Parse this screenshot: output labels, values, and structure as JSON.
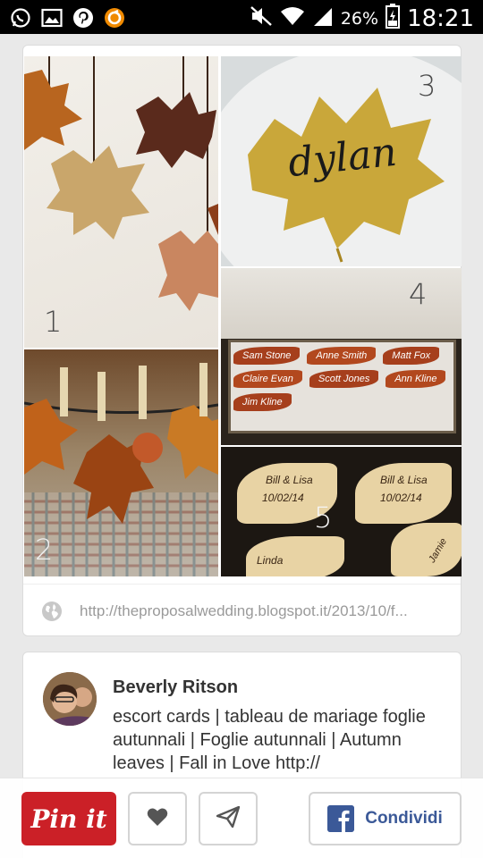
{
  "status_bar": {
    "battery": "26%",
    "time": "18:21",
    "left_icons": [
      "whatsapp-icon",
      "gallery-icon",
      "pinterest-icon",
      "orange-app-icon"
    ],
    "right_icons": [
      "mute-icon",
      "wifi-icon",
      "signal-icon",
      "battery-icon"
    ]
  },
  "collage": {
    "numbers": [
      "1",
      "2",
      "3",
      "4",
      "5"
    ],
    "place_card_name": "dylan",
    "leaf_tags": [
      "Sam Stone",
      "Anne Smith",
      "Matt Fox",
      "Claire Evan",
      "Scott Jones",
      "Ann Kline",
      "Jim Kline"
    ],
    "wood_tags": [
      "Bill & Lisa",
      "10/02/14",
      "Bill & Lisa",
      "10/02/14",
      "Linda",
      "Jamie"
    ]
  },
  "source": {
    "url": "http://theproposalwedding.blogspot.it/2013/10/f..."
  },
  "user": {
    "name": "Beverly Ritson",
    "description": "escort cards | tableau de mariage foglie autunnali | Foglie autunnali | Autumn leaves | Fall in Love http://"
  },
  "actions": {
    "pin_label": "Pin it",
    "share_label": "Condividi"
  },
  "colors": {
    "pin_red": "#cb2027",
    "facebook_blue": "#3b5998"
  }
}
